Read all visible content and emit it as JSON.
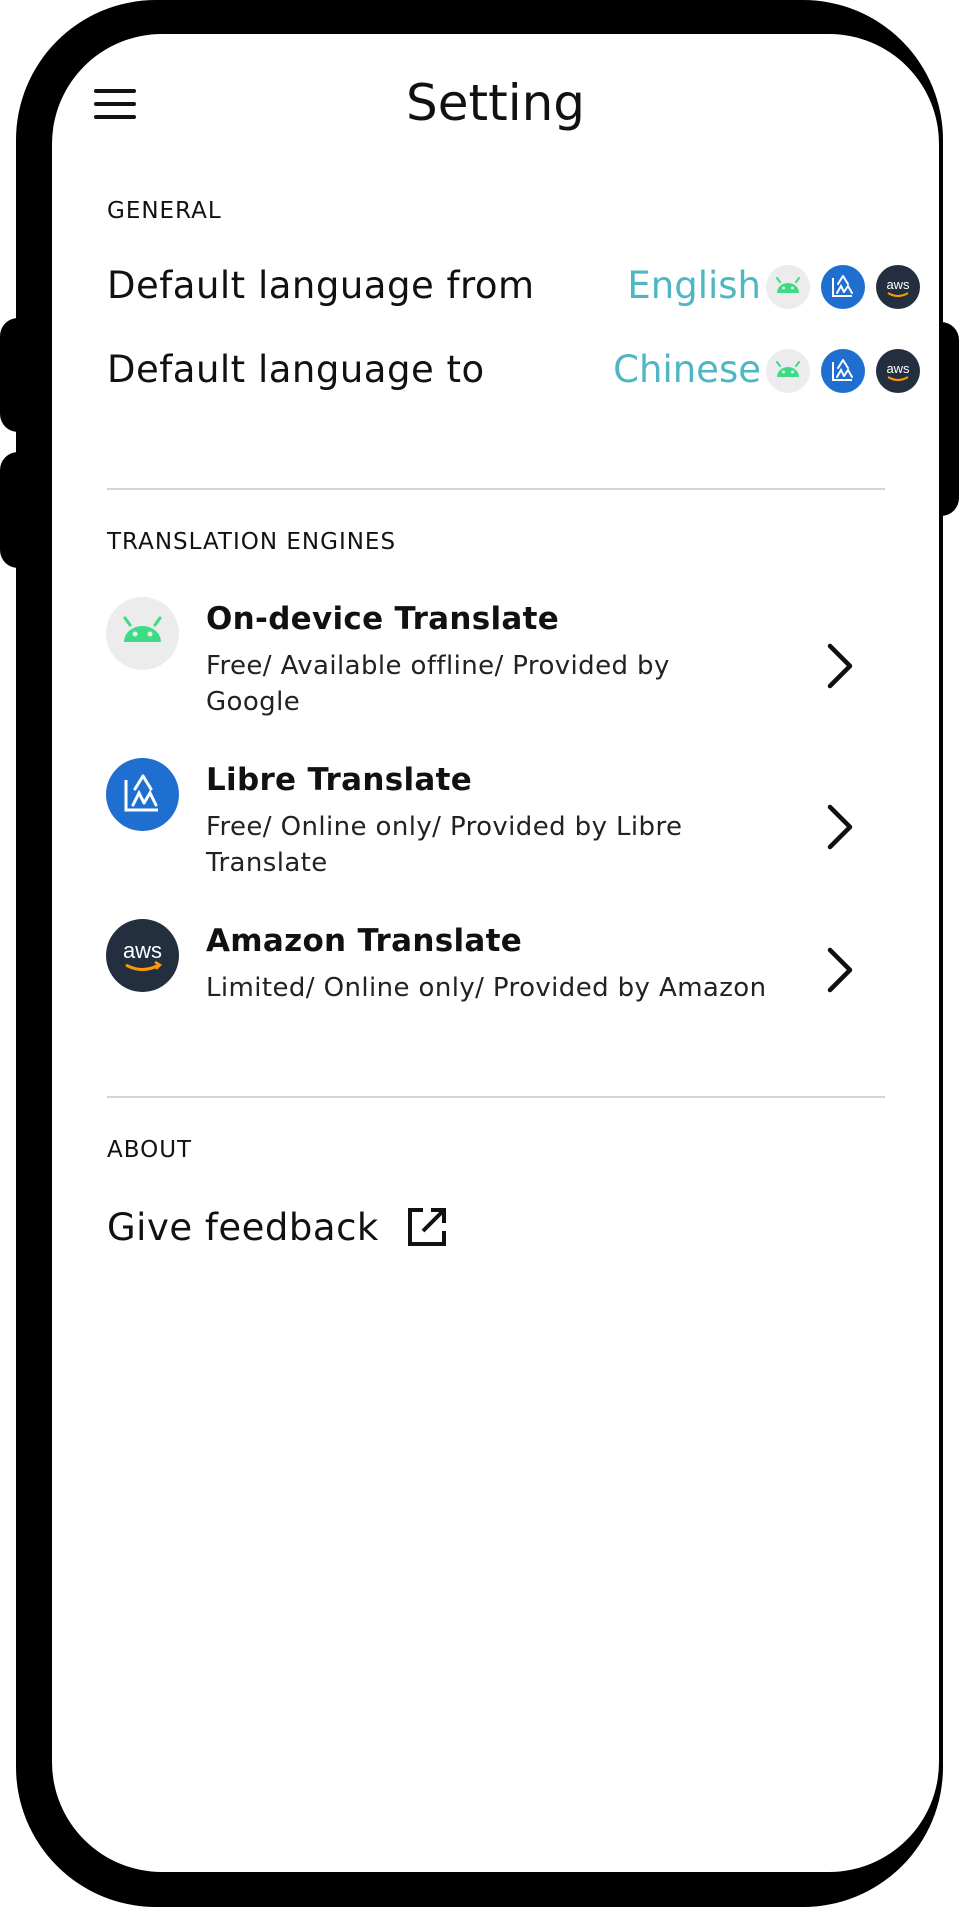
{
  "header": {
    "title": "Setting",
    "menu_icon": "hamburger-menu-icon"
  },
  "general": {
    "heading": "GENERAL",
    "from": {
      "label": "Default language from",
      "value": "English"
    },
    "to": {
      "label": "Default language to",
      "value": "Chinese"
    },
    "engine_icons": [
      "android-icon",
      "libre-translate-icon",
      "aws-icon"
    ]
  },
  "engines": {
    "heading": "TRANSLATION ENGINES",
    "items": [
      {
        "title": "On-device Translate",
        "desc": "Free/ Available offline/ Provided by Google",
        "icon": "android-icon"
      },
      {
        "title": "Libre Translate",
        "desc": "Free/ Online only/ Provided by Libre Translate",
        "icon": "libre-translate-icon"
      },
      {
        "title": "Amazon Translate",
        "desc": "Limited/ Online only/ Provided by Amazon",
        "icon": "aws-icon"
      }
    ]
  },
  "about": {
    "heading": "ABOUT",
    "feedback_label": "Give feedback",
    "feedback_icon": "open-external-icon"
  },
  "colors": {
    "accent": "#4fb6c4",
    "android_green": "#3ddc84",
    "libre_blue": "#1f6fd1",
    "aws_dark": "#232f3e",
    "aws_orange": "#ff9900"
  },
  "icon_text": {
    "aws": "aws"
  }
}
